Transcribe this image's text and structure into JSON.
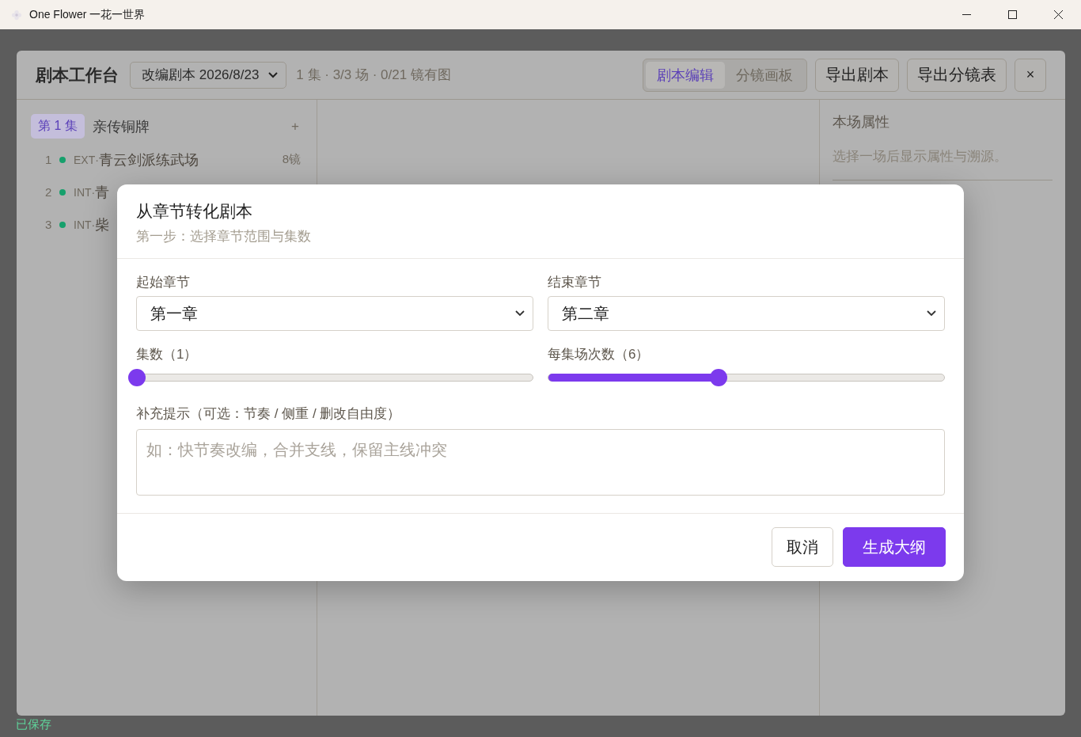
{
  "window": {
    "title": "One Flower 一花一世界"
  },
  "status_bar": {
    "text": "已保存"
  },
  "workbench": {
    "title": "剧本工作台",
    "script_select": "改编剧本 2026/8/23",
    "summary": "1 集 · 3/3 场 · 0/21 镜有图",
    "view_tabs": [
      {
        "label": "剧本编辑",
        "selected": true
      },
      {
        "label": "分镜画板",
        "selected": false
      }
    ],
    "buttons": [
      "导出剧本",
      "导出分镜表"
    ],
    "close": "×",
    "episode": {
      "badge": "第 1 集",
      "title": "亲传铜牌",
      "add": "+"
    },
    "scenes": [
      {
        "number": "1",
        "color": "#16a06c",
        "prefix": "EXT·",
        "title": "青云剑派练武场",
        "count": "8镜"
      },
      {
        "number": "2",
        "color": "#16a06c",
        "prefix": "INT·",
        "title": "青"
      },
      {
        "number": "3",
        "color": "#16a06c",
        "prefix": "INT·",
        "title": "柴"
      }
    ],
    "properties": {
      "title": "本场属性",
      "hint": "选择一场后显示属性与溯源。"
    }
  },
  "dialog": {
    "title": "从章节转化剧本",
    "subtitle": "第一步：选择章节范围与集数",
    "start": {
      "label": "起始章节",
      "value": "第一章"
    },
    "end": {
      "label": "结束章节",
      "value": "第二章"
    },
    "sliders": [
      {
        "label": "集数（1）",
        "level": 0
      },
      {
        "label": "每集场次数（6）",
        "level": 0.43
      }
    ],
    "hint": {
      "label": "补充提示（可选：节奏 / 侧重 / 删改自由度）",
      "placeholder": "如：快节奏改编，合并支线，保留主线冲突"
    },
    "buttons": [
      {
        "label": "取消",
        "kind": "secondary"
      },
      {
        "label": "生成大纲",
        "kind": "primary"
      }
    ]
  }
}
